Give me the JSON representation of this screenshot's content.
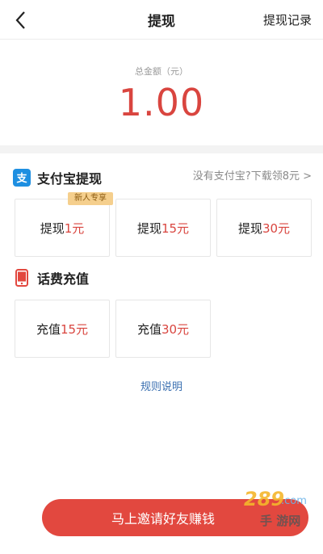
{
  "header": {
    "title": "提现",
    "right_label": "提现记录"
  },
  "balance": {
    "label": "总金额（元）",
    "amount": "1.00"
  },
  "alipay": {
    "title": "支付宝提现",
    "link": "没有支付宝?下载领8元 >",
    "badge": "新人专享",
    "options": [
      {
        "prefix": "提现",
        "amount": "1元"
      },
      {
        "prefix": "提现",
        "amount": "15元"
      },
      {
        "prefix": "提现",
        "amount": "30元"
      }
    ]
  },
  "phone": {
    "title": "话费充值",
    "options": [
      {
        "prefix": "充值",
        "amount": "15元"
      },
      {
        "prefix": "充值",
        "amount": "30元"
      }
    ]
  },
  "rules_label": "规则说明",
  "cta_label": "马上邀请好友赚钱",
  "watermark": {
    "logo": "289.com",
    "text": "手游网"
  },
  "colors": {
    "accent_red": "#d9453f",
    "alipay_blue": "#1e8fe1",
    "link_blue": "#3a6fb0",
    "badge_gold": "#f5cf8d"
  }
}
